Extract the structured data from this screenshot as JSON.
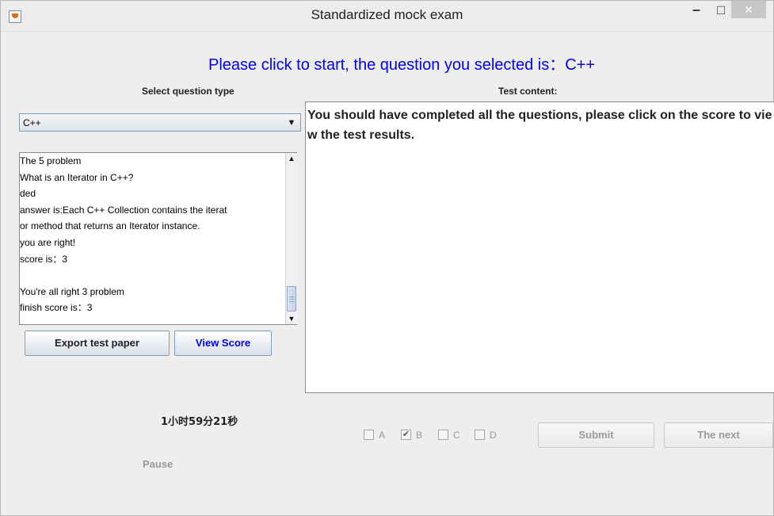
{
  "window": {
    "title": "Standardized mock exam",
    "min_symbol": "–",
    "max_symbol": "☐",
    "close_symbol": "✕"
  },
  "headline": "Please click to start, the question you selected is：C++",
  "left_panel": {
    "section_label": "Select question type",
    "question_type": {
      "selected": "C++",
      "arrow": "▼"
    },
    "log_lines": [
      "The 5 problem",
      "What is an Iterator in C++?",
      "ded",
      "answer is:Each C++ Collection contains the iterat",
      "or method that returns an Iterator instance.",
      "you are right!",
      "score is：3",
      "",
      "You're all right 3 problem",
      "finish score is：3"
    ],
    "scroll_up": "▲",
    "scroll_down": "▼",
    "export_label": "Export test paper",
    "view_score_label": "View Score"
  },
  "right_panel": {
    "section_label": "Test content:",
    "content": "You should have completed all the questions, please click on the score to view the test results."
  },
  "footer": {
    "timer": "1小时59分21秒",
    "pause_label": "Pause",
    "options": [
      {
        "label": "A",
        "checked": false
      },
      {
        "label": "B",
        "checked": true
      },
      {
        "label": "C",
        "checked": false
      },
      {
        "label": "D",
        "checked": false
      }
    ],
    "check_mark": "✔",
    "submit_label": "Submit",
    "next_label": "The next"
  },
  "colors": {
    "accent": "#0000ff",
    "disabled_text": "#9a9a9a",
    "window_bg": "#eeeeee"
  }
}
